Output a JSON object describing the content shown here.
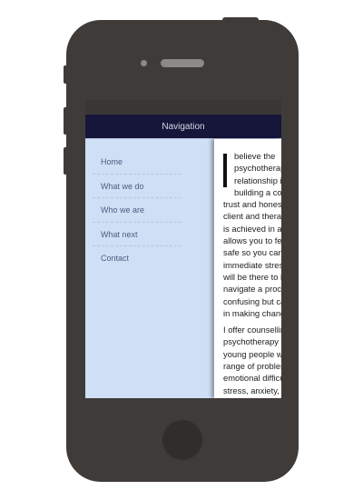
{
  "navbar": {
    "title": "Navigation"
  },
  "menu": {
    "items": [
      {
        "label": "Home"
      },
      {
        "label": "What we do"
      },
      {
        "label": "Who we are"
      },
      {
        "label": "What next"
      },
      {
        "label": "Contact"
      }
    ]
  },
  "content": {
    "dropcap": "I",
    "para1": "believe the psychotherapeutic relationship is about building a connection of trust and honesty between the client and therapist. I hope this is achieved in a way that allows you to feel relaxed and safe so you can explore any immediate stress or distress. I will be there to help you navigate a process that is often confusing but can support you in making changes.",
    "para2": "I offer counselling and psychotherapy for adults and young people with a wide range of problems and emotional difficulties, including stress, anxiety, relationship problems, depression. I also have particular experience with addiction and recovery."
  },
  "colors": {
    "phone_body": "#3f3b38",
    "navbar": "#16163a",
    "menu_background": "#cfdff5",
    "menu_text": "#4a5e80"
  }
}
